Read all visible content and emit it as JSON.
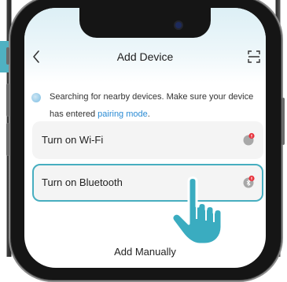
{
  "header": {
    "title": "Add Device"
  },
  "search": {
    "text_main": "Searching for nearby devices. Make sure your device has entered ",
    "link_text": "pairing mode",
    "text_end": "."
  },
  "cards": [
    {
      "label": "Turn on Wi-Fi"
    },
    {
      "label": "Turn on Bluetooth"
    }
  ],
  "footer": {
    "manual_label": "Add Manually"
  },
  "colors": {
    "accent": "#47aec0",
    "link": "#2a8bd4",
    "alert": "#e8333d"
  },
  "icons": [
    "back-icon",
    "scan-icon",
    "searching-icon",
    "wifi-status-icon",
    "bluetooth-status-icon",
    "pointing-hand-icon"
  ]
}
